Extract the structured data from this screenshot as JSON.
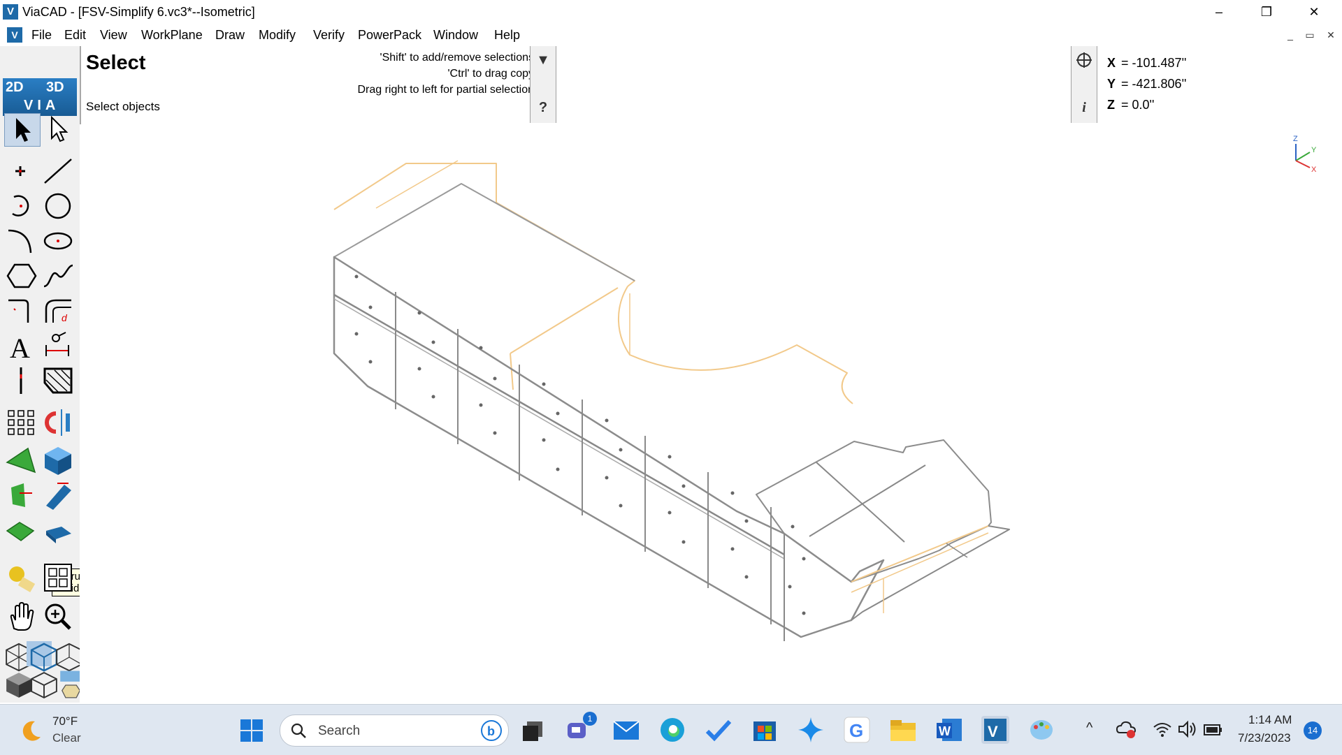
{
  "app": {
    "title": "ViaCAD - [FSV-Simplify 6.vc3*--Isometric]",
    "icon_letter": "V",
    "accent": "#1e6aa8"
  },
  "window_controls": {
    "minimize": "–",
    "restore": "❐",
    "close": "✕"
  },
  "menu": {
    "items": [
      "File",
      "Edit",
      "View",
      "WorkPlane",
      "Draw",
      "Modify",
      "Verify",
      "PowerPack",
      "Window",
      "Help"
    ],
    "mdi": {
      "minimize": "_",
      "restore": "▭",
      "close": "✕"
    }
  },
  "prompt": {
    "title": "Select",
    "subtitle": "Select objects",
    "hints": [
      "'Shift' to add/remove selections",
      "'Ctrl' to drag copy",
      "Drag right to left for partial selection"
    ],
    "help_glyph": "?",
    "dropdown_glyph": "▼"
  },
  "coords": {
    "x_label": "X",
    "x_value": "= -101.487''",
    "y_label": "Y",
    "y_value": "= -421.806''",
    "z_label": "Z",
    "z_value": "= 0.0''",
    "info_glyph": "i"
  },
  "logo": {
    "left": "2D",
    "right": "3D",
    "bottom": "VIA"
  },
  "tooltip": {
    "text": "Extrude Solid"
  },
  "axis": {
    "z": "Z",
    "y": "Y",
    "x": "X"
  },
  "taskbar": {
    "weather_temp": "70°F",
    "weather_condition": "Clear",
    "search_placeholder": "Search",
    "chat_badge": "1",
    "clock_time": "1:14 AM",
    "clock_date": "7/23/2023",
    "notification_count": "14"
  }
}
